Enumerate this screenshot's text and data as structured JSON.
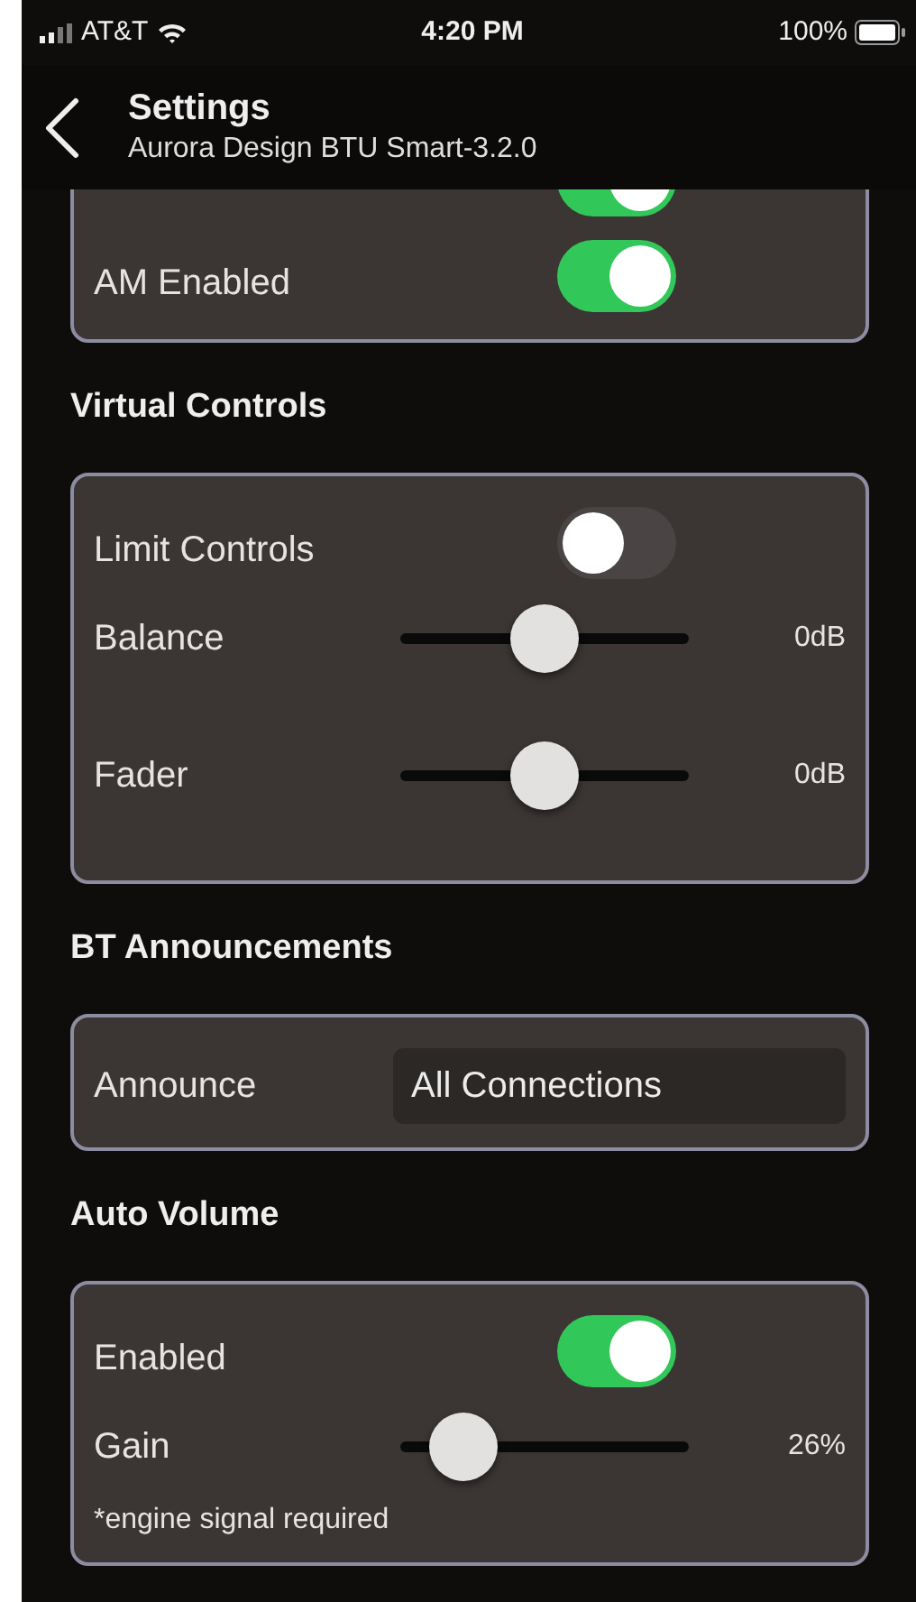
{
  "status_bar": {
    "carrier": "AT&T",
    "time": "4:20 PM",
    "battery": "100%"
  },
  "header": {
    "title": "Settings",
    "subtitle": "Aurora Design BTU Smart-3.2.0"
  },
  "sections": [
    {
      "rows": [
        {
          "kind": "toggle",
          "on": true
        },
        {
          "kind": "toggle",
          "label": "AM Enabled",
          "on": true
        }
      ]
    },
    {
      "title": "Virtual Controls",
      "rows": [
        {
          "kind": "toggle",
          "label": "Limit Controls",
          "on": false
        },
        {
          "kind": "slider",
          "label": "Balance",
          "level": 0.5,
          "reading": "0dB"
        },
        {
          "kind": "slider",
          "label": "Fader",
          "level": 0.5,
          "reading": "0dB"
        }
      ]
    },
    {
      "title": "BT Announcements",
      "rows": [
        {
          "kind": "select",
          "label": "Announce",
          "value": "All Connections"
        }
      ]
    },
    {
      "title": "Auto Volume",
      "rows": [
        {
          "kind": "toggle",
          "label": "Enabled",
          "on": true
        },
        {
          "kind": "slider",
          "label": "Gain",
          "level": 0.22,
          "reading": "26%"
        },
        {
          "kind": "note",
          "text": "*engine signal required"
        }
      ]
    }
  ]
}
